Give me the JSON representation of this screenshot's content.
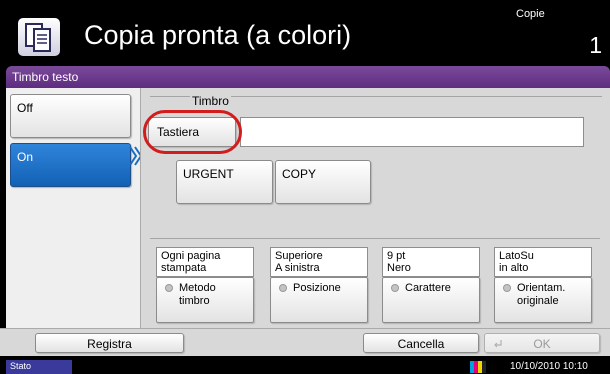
{
  "header": {
    "title": "Copia pronta (a colori)",
    "copies_label": "Copie",
    "copies": "1",
    "icon": "copy-icon"
  },
  "dialog": {
    "title": "Timbro testo"
  },
  "left": {
    "off_label": "Off",
    "on_label": "On",
    "selected": "On"
  },
  "stamp": {
    "group_label": "Timbro",
    "tastiera_label": "Tastiera",
    "text_value": "",
    "presets": [
      "URGENT",
      "COPY"
    ]
  },
  "settings": [
    {
      "value": "Ogni pagina\nstampata",
      "button": "Metodo\ntimbro"
    },
    {
      "value": "Superiore\nA sinistra",
      "button": "Posizione"
    },
    {
      "value": "9 pt\nNero",
      "button": "Carattere"
    },
    {
      "value": "LatoSu\nin alto",
      "button": "Orientam.\noriginale"
    }
  ],
  "footer": {
    "registra": "Registra",
    "cancella": "Cancella",
    "ok": "OK"
  },
  "status": {
    "stato": "Stato",
    "datetime": "10/10/2010  10:10"
  },
  "colors": {
    "accent_blue": "#1a6dc4",
    "title_purple": "#6a3a8d",
    "highlight_red": "#d21d1d"
  }
}
